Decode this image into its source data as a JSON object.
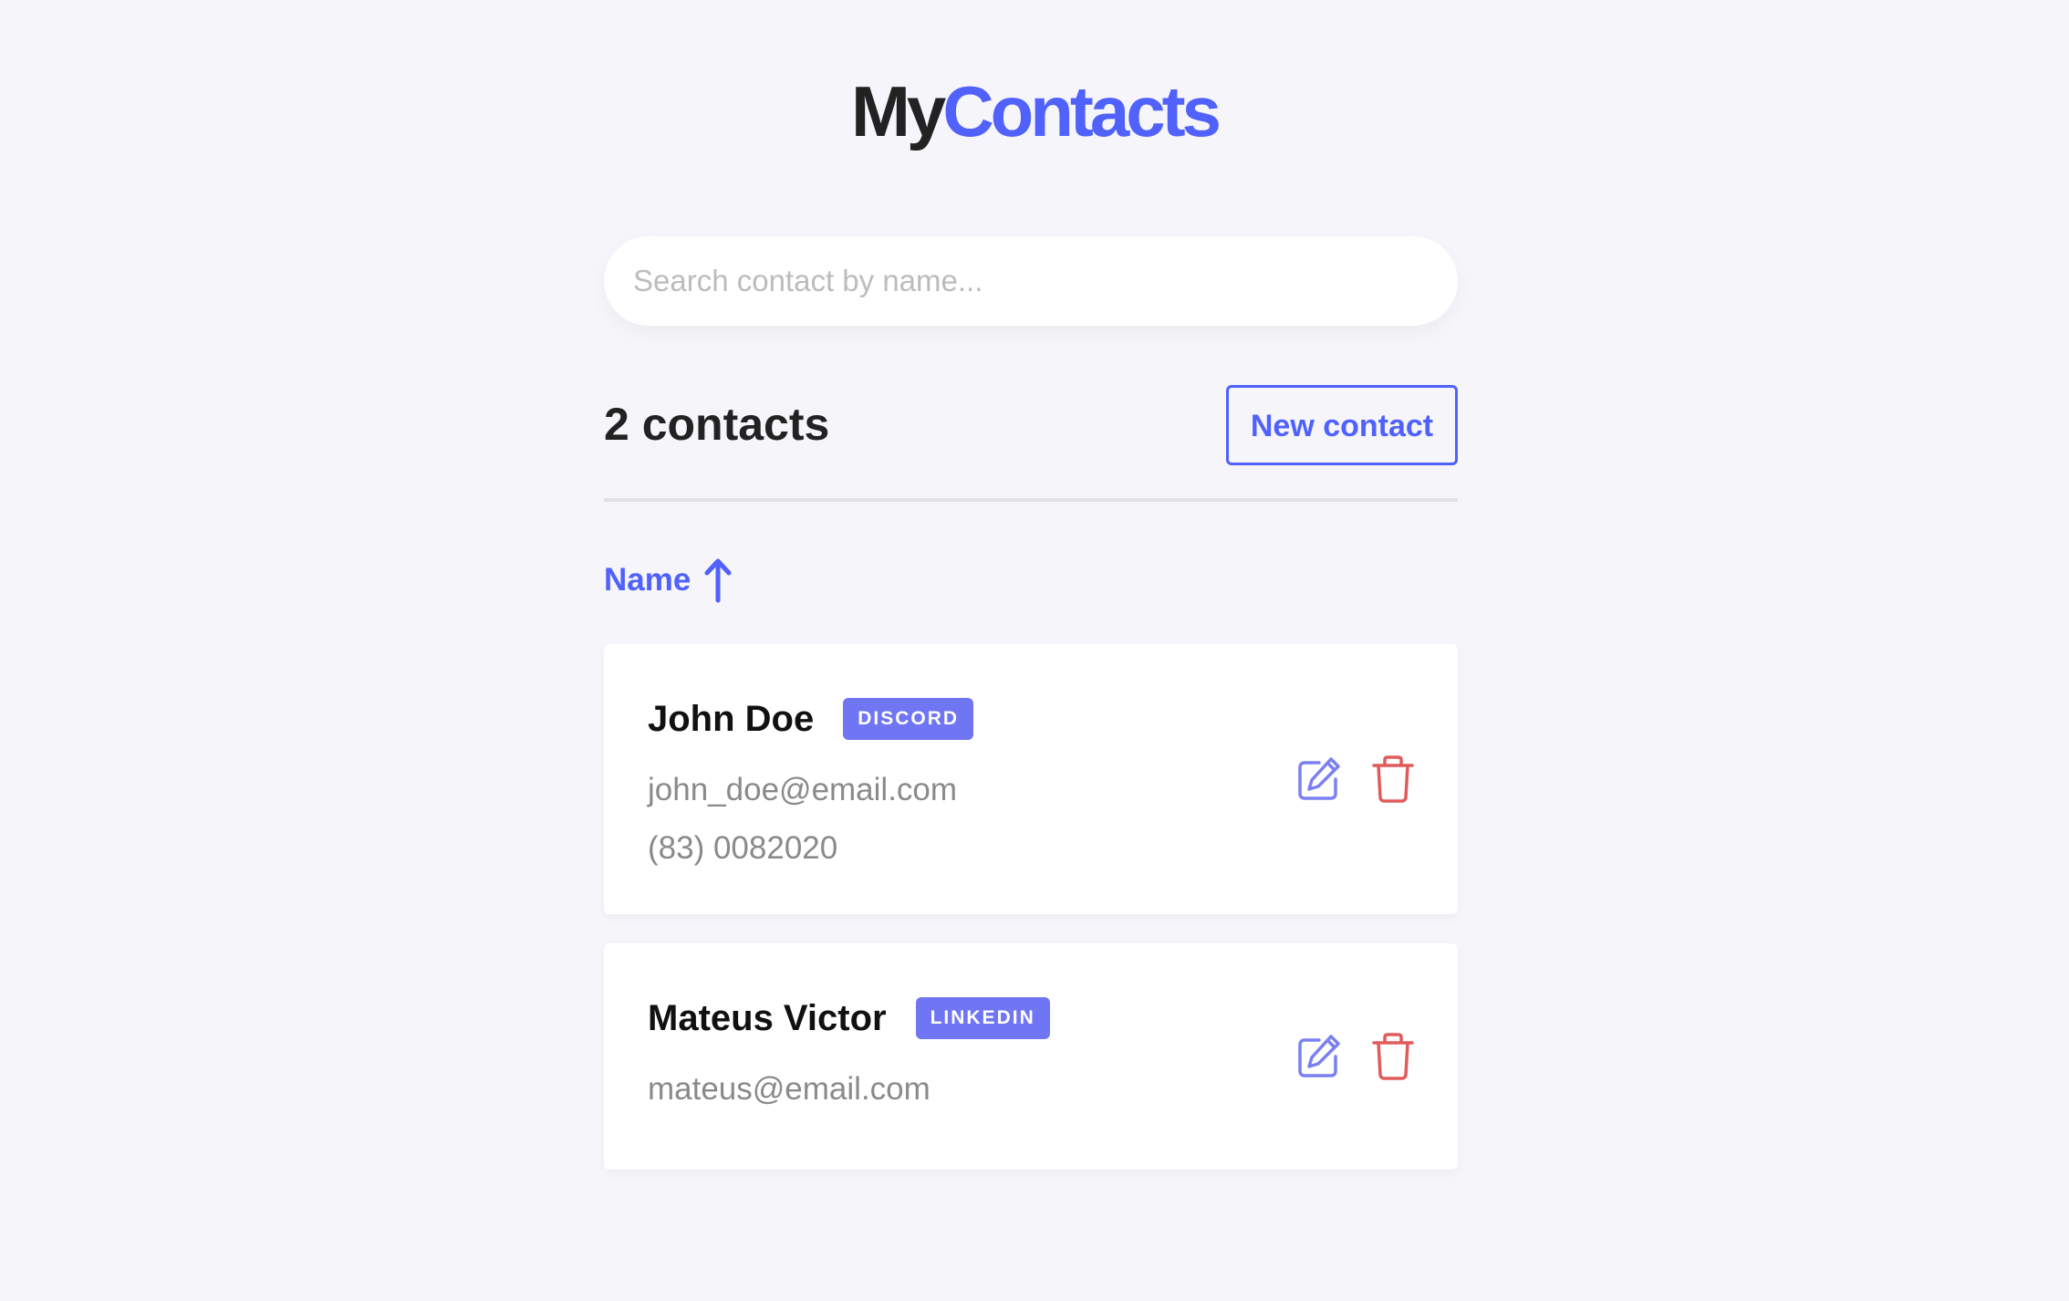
{
  "app": {
    "title_part1": "My",
    "title_part2": "Contacts",
    "brand_color": "#5061fc",
    "badge_color": "#7075f4",
    "delete_color": "#e25b5b"
  },
  "search": {
    "placeholder": "Search contact by name...",
    "value": ""
  },
  "header": {
    "count_label": "2 contacts",
    "new_contact_label": "New contact"
  },
  "sort": {
    "label": "Name",
    "direction_icon": "arrow-up-icon"
  },
  "contacts": [
    {
      "name": "John Doe",
      "category": "DISCORD",
      "email": "john_doe@email.com",
      "phone": "(83) 0082020",
      "edit_icon": "edit-icon",
      "delete_icon": "trash-icon"
    },
    {
      "name": "Mateus Victor",
      "category": "LINKEDIN",
      "email": "mateus@email.com",
      "edit_icon": "edit-icon",
      "delete_icon": "trash-icon"
    }
  ]
}
